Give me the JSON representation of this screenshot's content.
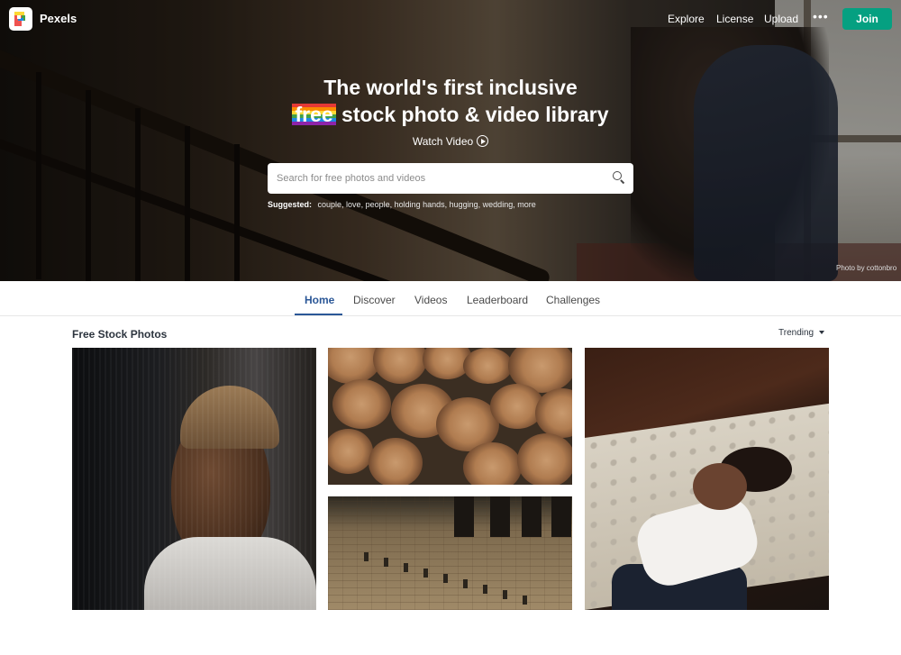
{
  "brand": {
    "name": "Pexels",
    "logo_icon": "pexels-logo-icon"
  },
  "nav": {
    "links": [
      "Explore",
      "License",
      "Upload"
    ],
    "more_icon": "more-dots-icon",
    "more_label": "•••",
    "join_label": "Join",
    "join_color": "#05a081"
  },
  "hero": {
    "headline_line1": "The world's first inclusive",
    "headline_free": "free",
    "headline_line2_rest": "stock photo & video library",
    "watch_label": "Watch Video",
    "watch_icon": "play-circle-icon",
    "search_placeholder": "Search for free photos and videos",
    "search_icon": "search-icon",
    "suggested_label": "Suggested:",
    "suggested_tags": "couple, love, people, holding hands, hugging, wedding, more",
    "credit": "Photo by cottonbro"
  },
  "tabs": {
    "items": [
      "Home",
      "Discover",
      "Videos",
      "Leaderboard",
      "Challenges"
    ],
    "active": "Home",
    "active_color": "#2b5797"
  },
  "section": {
    "title": "Free Stock Photos",
    "sort_label": "Trending",
    "sort_icon": "caret-down-icon"
  }
}
